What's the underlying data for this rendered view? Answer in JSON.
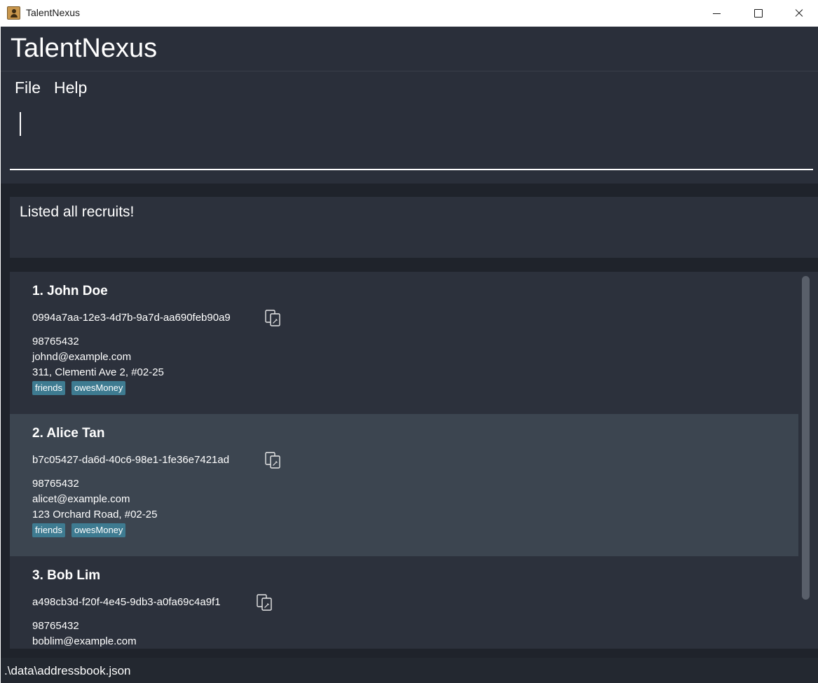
{
  "window": {
    "title": "TalentNexus",
    "icon": "contacts-book-icon"
  },
  "app": {
    "name": "TalentNexus",
    "menu": {
      "file_label": "File",
      "help_label": "Help"
    },
    "command": {
      "value": "",
      "placeholder": ""
    },
    "result": {
      "message": "Listed all recruits!"
    },
    "persons": [
      {
        "index_name": "1.  John Doe",
        "id": "0994a7aa-12e3-4d7b-9a7d-aa690feb90a9",
        "phone": "98765432",
        "email": "johnd@example.com",
        "address": "311, Clementi Ave 2, #02-25",
        "tags": [
          "friends",
          "owesMoney"
        ],
        "copy_icon": "copy-id-icon"
      },
      {
        "index_name": "2.  Alice Tan",
        "id": "b7c05427-da6d-40c6-98e1-1fe36e7421ad",
        "phone": "98765432",
        "email": "alicet@example.com",
        "address": "123 Orchard Road, #02-25",
        "tags": [
          "friends",
          "owesMoney"
        ],
        "copy_icon": "copy-id-icon"
      },
      {
        "index_name": "3.  Bob Lim",
        "id": "a498cb3d-f20f-4e45-9db3-a0fa69c4a9f1",
        "phone": "98765432",
        "email": "boblim@example.com",
        "address": "",
        "tags": [],
        "copy_icon": "copy-id-icon"
      }
    ],
    "status": {
      "file_path": ".\\data\\addressbook.json"
    },
    "colors": {
      "background": "#1f232b",
      "panel": "#2c313c",
      "selected_card": "#3c4550",
      "tag": "#3e7b91",
      "text": "#ffffff"
    }
  }
}
